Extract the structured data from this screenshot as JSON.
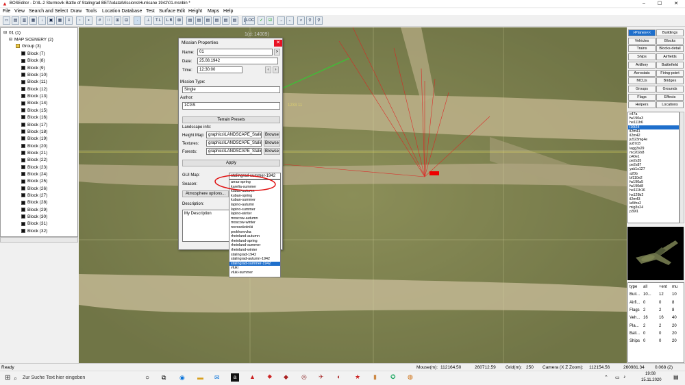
{
  "window": {
    "title": "BOSEditor - D:\\IL-2 Sturmovik Battle of Stalingrad BETA\\data\\Missions\\Hurricane 1942\\01.msnbin *",
    "minimize": "–",
    "maximize": "☐",
    "close": "✕"
  },
  "menu": [
    "File",
    "View",
    "Search and Select",
    "Draw",
    "Tools",
    "Location Database",
    "Test",
    "Surface Edit",
    "Height",
    "Maps",
    "Help"
  ],
  "toolbar": {
    "tl_label": "T.L",
    "lb_label": "L.B",
    "loc_label": "LOC"
  },
  "tree": {
    "root": "01 (1)",
    "scenery": "MAP SCENERY (2)",
    "group": "Group (3)",
    "blocks": [
      "Block (7)",
      "Block (8)",
      "Block (9)",
      "Block (10)",
      "Block (11)",
      "Block (12)",
      "Block (13)",
      "Block (14)",
      "Block (15)",
      "Block (16)",
      "Block (17)",
      "Block (18)",
      "Block (19)",
      "Block (20)",
      "Block (21)",
      "Block (22)",
      "Block (23)",
      "Block (24)",
      "Block (25)",
      "Block (26)",
      "Block (27)",
      "Block (28)",
      "Block (29)",
      "Block (30)",
      "Block (31)",
      "Block (32)"
    ]
  },
  "map": {
    "marker1": "1(d: 14009)",
    "marker2": "1233 11"
  },
  "dialog": {
    "title": "Mission Properties",
    "name_label": "Name:",
    "name_value": "01",
    "date_label": "Date:",
    "date_value": "25.08.1942",
    "time_label": "Time:",
    "time_value": "12:30:00",
    "mission_type_label": "Mission Type:",
    "mission_type_value": "Single",
    "author_label": "Author:",
    "author_value": "1CGS",
    "terrain_presets": "Terrain Presets",
    "landscape_label": "Landscape info:",
    "heightmap_label": "Height Map:",
    "heightmap_value": "graphics\\LANDSCAPE_Stalin",
    "textures_label": "Textures:",
    "textures_value": "graphics\\LANDSCAPE_Stalin",
    "forests_label": "Forests:",
    "forests_value": "graphics\\LANDSCAPE_Stalin",
    "browse": "Browse",
    "apply": "Apply",
    "gui_map_label": "GUI Map:",
    "gui_map_value": "stalingrad-summer-1942",
    "season_label": "Season:",
    "atmosphere": "Atmosphere options...",
    "description_label": "Description:",
    "description_value": "My Description",
    "gui_map_options": [
      "arras-spring",
      "karelia-summer",
      "kuban-autumn",
      "kuban-spring",
      "kuban-summer",
      "lapino-autumn",
      "lapino-summer",
      "lapino-winter",
      "moscow-autumn",
      "moscow-winter",
      "novosokolniki",
      "prokhorovka",
      "rheinland-autumn",
      "rheinland-spring",
      "rheinland-summer",
      "rheinland-winter",
      "stalingrad-1942",
      "stalingrad-autumn-1942",
      "stalingrad-summer-1942",
      "vluki",
      "vluki-summer"
    ],
    "selected_option": "stalingrad-summer-1942",
    "highlight_color": "#1e6fcc"
  },
  "right_panel": {
    "buttons": [
      ">Planes<<",
      "Buildings",
      "Vehicles",
      "Blocks",
      "Trains",
      "Blocks-detail",
      "Ships",
      "Airfields",
      "Artillery",
      "Battlefield",
      "Aerostats",
      "Firing-point",
      "MCUs",
      "Bridges",
      "Groups",
      "Grounds",
      "Flags",
      "Effects",
      "Helpers",
      "Locations"
    ],
    "planes": [
      "c47a",
      "fw190a3",
      "he111h6",
      "i16t24",
      "il2m41",
      "il2m42",
      "ju523mg4e",
      "ju87d3",
      "lagg3s29",
      "mc202s8",
      "p40e1",
      "pe2s35",
      "pe2s87",
      "yak1s127",
      "a20b",
      "bf110e2",
      "fw190a5",
      "fw190d8",
      "he111h16",
      "hs129b2",
      "il2m43",
      "la5fns2",
      "mig3s24",
      "p39l1"
    ],
    "selected_plane": "i16t24",
    "stats_headers": [
      "type",
      "all",
      "+ent",
      "mu"
    ],
    "stats_rows": [
      [
        "Buil...",
        "10...",
        "12",
        "10"
      ],
      [
        "Airfi...",
        "0",
        "0",
        "8"
      ],
      [
        "Flags",
        "2",
        "2",
        "8"
      ],
      [
        "Veh...",
        "16",
        "16",
        "40"
      ],
      [
        "Pla...",
        "2",
        "2",
        "20"
      ],
      [
        "Ball...",
        "0",
        "0",
        "20"
      ],
      [
        "Ships",
        "0",
        "0",
        "20"
      ]
    ]
  },
  "statusbar": {
    "ready": "Ready",
    "mouse_label": "Mouse(m):",
    "mouse_x": "112164.50",
    "mouse_z": "260712.59",
    "grid_label": "Grid(m):",
    "grid_value": "250",
    "camera_label": "Camera (X Z Zoom):",
    "camera_x": "112154.56",
    "camera_z": "260981.34",
    "camera_zoom": "0.068 (2)"
  },
  "taskbar": {
    "search_placeholder": "Zur Suche Text hier eingeben",
    "time": "19:08",
    "date": "15.11.2020"
  }
}
